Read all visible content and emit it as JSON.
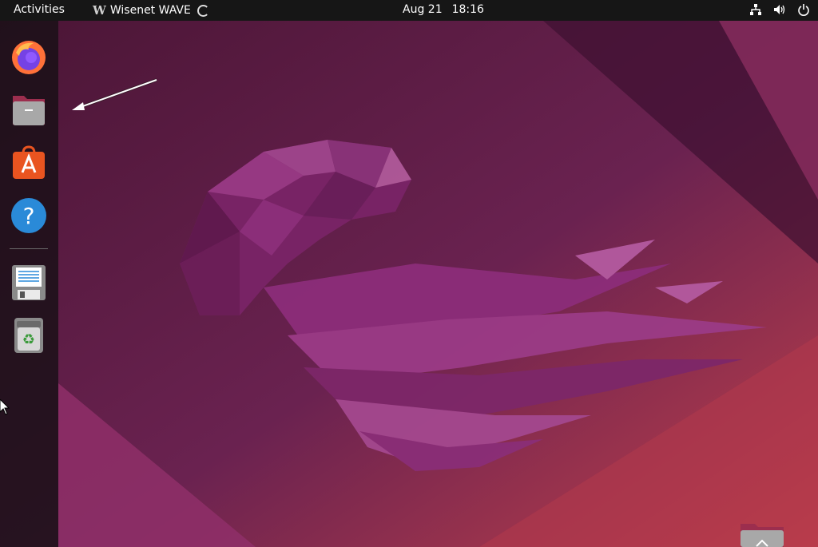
{
  "topbar": {
    "activities": "Activities",
    "app_name": "Wisenet WAVE",
    "app_logo_letter": "W",
    "date": "Aug 21",
    "time": "18:16"
  },
  "dock": {
    "items": [
      {
        "name": "firefox",
        "icon": "firefox-icon"
      },
      {
        "name": "files",
        "icon": "files-folder-icon"
      },
      {
        "name": "software",
        "icon": "app-center-icon"
      },
      {
        "name": "help",
        "icon": "help-icon"
      },
      {
        "name": "text-editor",
        "icon": "floppy-text-editor-icon"
      },
      {
        "name": "trash",
        "icon": "trash-recycle-icon"
      }
    ]
  },
  "colors": {
    "topbar": "#161616",
    "wallpaper_base": "#5c1f43",
    "jellyfish": "#8c2d7a",
    "accent_orange": "#e95420"
  }
}
